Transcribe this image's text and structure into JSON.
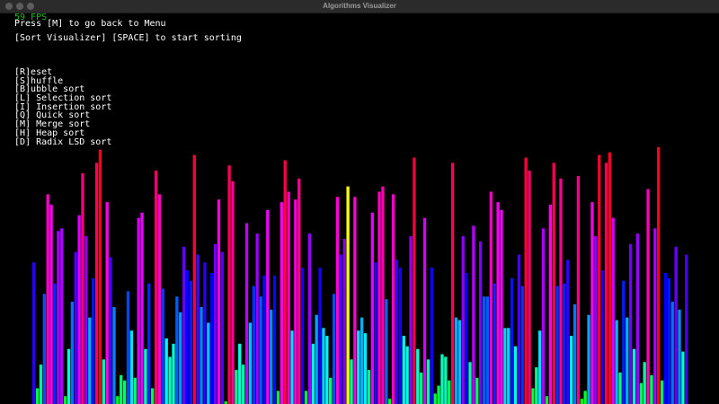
{
  "window": {
    "title": "Algorithms Visualizer"
  },
  "overlay": {
    "fps": "59 FPS",
    "back_hint": "Press [M] to go back to Menu",
    "start_hint": "[Sort Visualizer] [SPACE] to start sorting",
    "menu_items": [
      "[R]eset",
      "[S]huffle",
      "[B]ubble sort",
      "[L] Selection sort",
      "[I] Insertion sort",
      "[Q] Quick sort",
      "[M] Merge sort",
      "[H] Heap sort",
      "[D] Radix LSD sort"
    ]
  },
  "visualizer": {
    "max_value": 100,
    "highlight_color": "#ffff00",
    "highlight_index": 90,
    "values": [
      54,
      6,
      15,
      42,
      80,
      76,
      46,
      66,
      67,
      3,
      21,
      39,
      58,
      72,
      88,
      64,
      33,
      48,
      92,
      97,
      17,
      77,
      56,
      37,
      3,
      11,
      9,
      43,
      28,
      10,
      71,
      73,
      21,
      46,
      6,
      89,
      80,
      44,
      25,
      18,
      23,
      41,
      35,
      60,
      51,
      47,
      95,
      57,
      37,
      54,
      31,
      50,
      61,
      78,
      58,
      1,
      91,
      85,
      13,
      23,
      15,
      69,
      31,
      45,
      65,
      41,
      49,
      74,
      36,
      49,
      5,
      77,
      93,
      81,
      28,
      78,
      86,
      52,
      5,
      65,
      23,
      34,
      52,
      29,
      26,
      10,
      42,
      79,
      57,
      63,
      83,
      17,
      79,
      28,
      33,
      27,
      13,
      73,
      54,
      81,
      83,
      40,
      2,
      80,
      55,
      52,
      26,
      22,
      64,
      94,
      21,
      12,
      71,
      17,
      52,
      4,
      7,
      19,
      18,
      9,
      92,
      33,
      32,
      64,
      50,
      16,
      68,
      10,
      62,
      41,
      41,
      81,
      46,
      77,
      74,
      29,
      29,
      48,
      22,
      57,
      45,
      94,
      89,
      6,
      14,
      28,
      67,
      3,
      76,
      92,
      45,
      86,
      46,
      55,
      26,
      38,
      87,
      2,
      5,
      34,
      77,
      64,
      95,
      51,
      92,
      96,
      71,
      32,
      12,
      47,
      33,
      61,
      21,
      65,
      8,
      16,
      82,
      11,
      67,
      98,
      9,
      50,
      48,
      39,
      60,
      36,
      20,
      57
    ]
  }
}
